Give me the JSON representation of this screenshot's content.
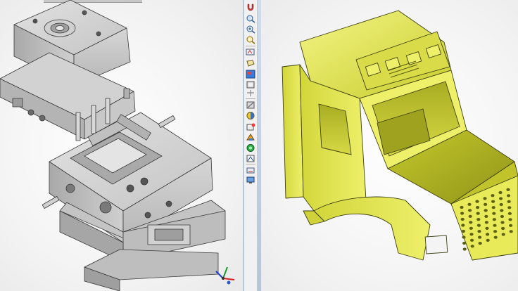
{
  "colors": {
    "mold_gray": "#c9c9c9",
    "mold_dark": "#8e8e8e",
    "cab_yellow": "#e2e64a",
    "cab_shadow": "#9ea21f",
    "divider": "#b8c7da",
    "triad_x": "#d22020",
    "triad_y": "#1a9a2a",
    "triad_z": "#1f3fd0"
  },
  "left_viewport": {
    "model": "injection-mold-assembly"
  },
  "right_viewport": {
    "model": "truck-cab-part"
  },
  "toolbar": {
    "buttons": [
      {
        "name": "magnet-icon"
      },
      {
        "name": "zoom-fit-icon"
      },
      {
        "name": "zoom-in-icon"
      },
      {
        "name": "zoom-window-icon"
      },
      {
        "name": "zoom-previous-icon"
      },
      {
        "name": "view-orientation-icon"
      },
      {
        "name": "sketch-icon"
      },
      {
        "name": "display-style-icon"
      },
      {
        "name": "section-view-icon"
      },
      {
        "name": "hide-show-icon"
      },
      {
        "name": "appearance-icon"
      },
      {
        "name": "scene-icon"
      },
      {
        "name": "view-settings-icon"
      },
      {
        "name": "lighting-icon"
      },
      {
        "name": "camera-icon"
      },
      {
        "name": "render-icon"
      },
      {
        "name": "monitor-icon"
      }
    ]
  },
  "triad": {
    "axes": [
      "x",
      "y",
      "z"
    ]
  }
}
